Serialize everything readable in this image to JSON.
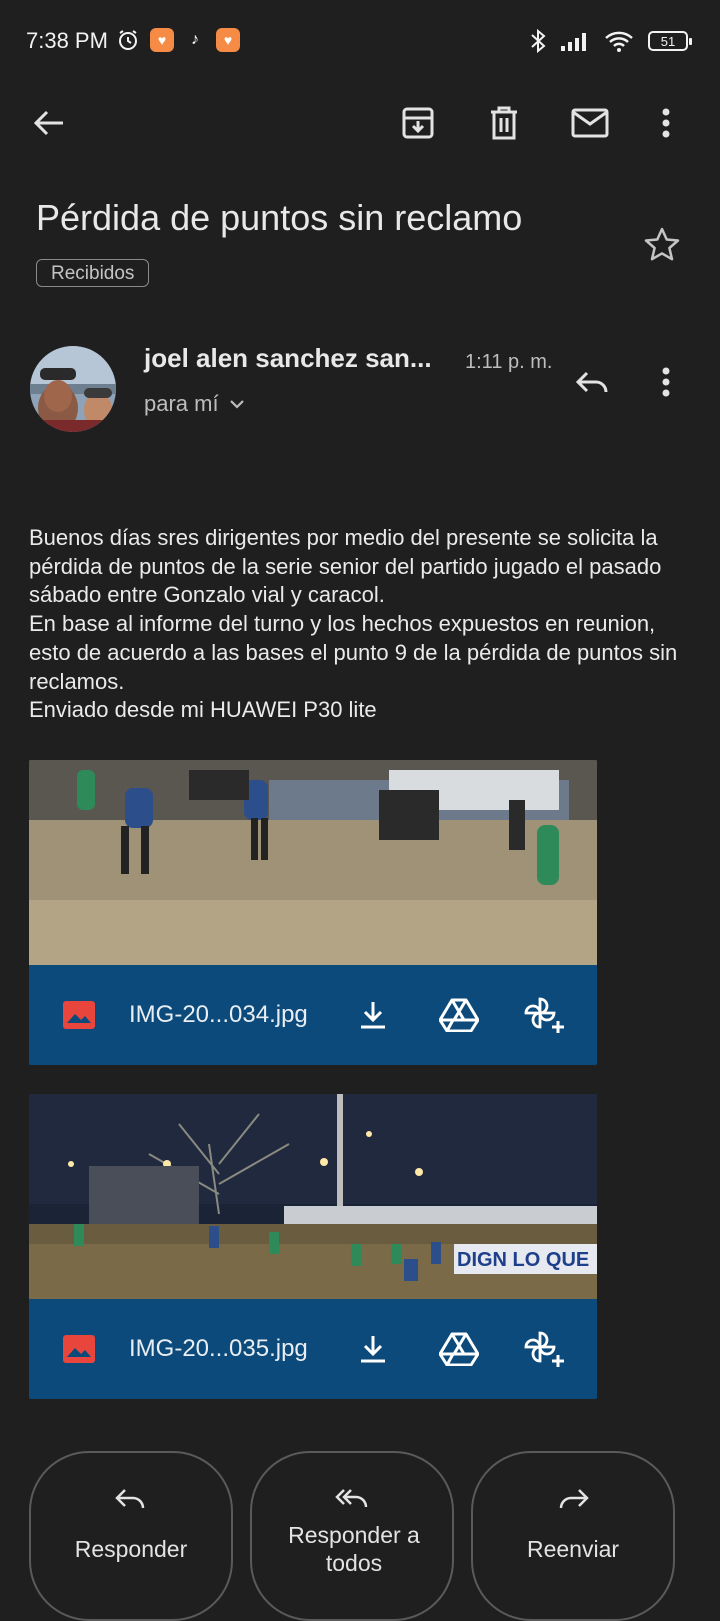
{
  "status_bar": {
    "time": "7:38 PM",
    "battery": "51"
  },
  "email": {
    "subject": "Pérdida de puntos sin reclamo",
    "label": "Recibidos",
    "sender": "joel alen sanchez san...",
    "time": "1:11 p. m.",
    "recipient": "para mí",
    "body": "Buenos días sres dirigentes por medio del presente se solicita la pérdida de puntos de la serie senior del partido jugado el pasado sábado entre Gonzalo vial y caracol.\nEn base al informe del turno y los hechos expuestos en reunion, esto de acuerdo a las bases el punto 9 de la pérdida de puntos sin reclamos.\nEnviado desde mi HUAWEI P30 lite"
  },
  "attachments": [
    {
      "filename": "IMG-20...034.jpg"
    },
    {
      "filename": "IMG-20...035.jpg",
      "banner_text": "DIGN LO QUE"
    }
  ],
  "actions": {
    "reply": "Responder",
    "reply_all": "Responder a todos",
    "forward": "Reenviar"
  },
  "colors": {
    "background": "#1f1f1f",
    "attachment_bar": "#0b4a7a",
    "image_icon": "#e8453c"
  },
  "icons": {
    "toolbar": [
      "back-arrow-icon",
      "archive-icon",
      "delete-icon",
      "mail-icon",
      "more-vert-icon"
    ],
    "attachment": [
      "image-icon",
      "download-icon",
      "drive-icon",
      "photos-add-icon"
    ]
  }
}
